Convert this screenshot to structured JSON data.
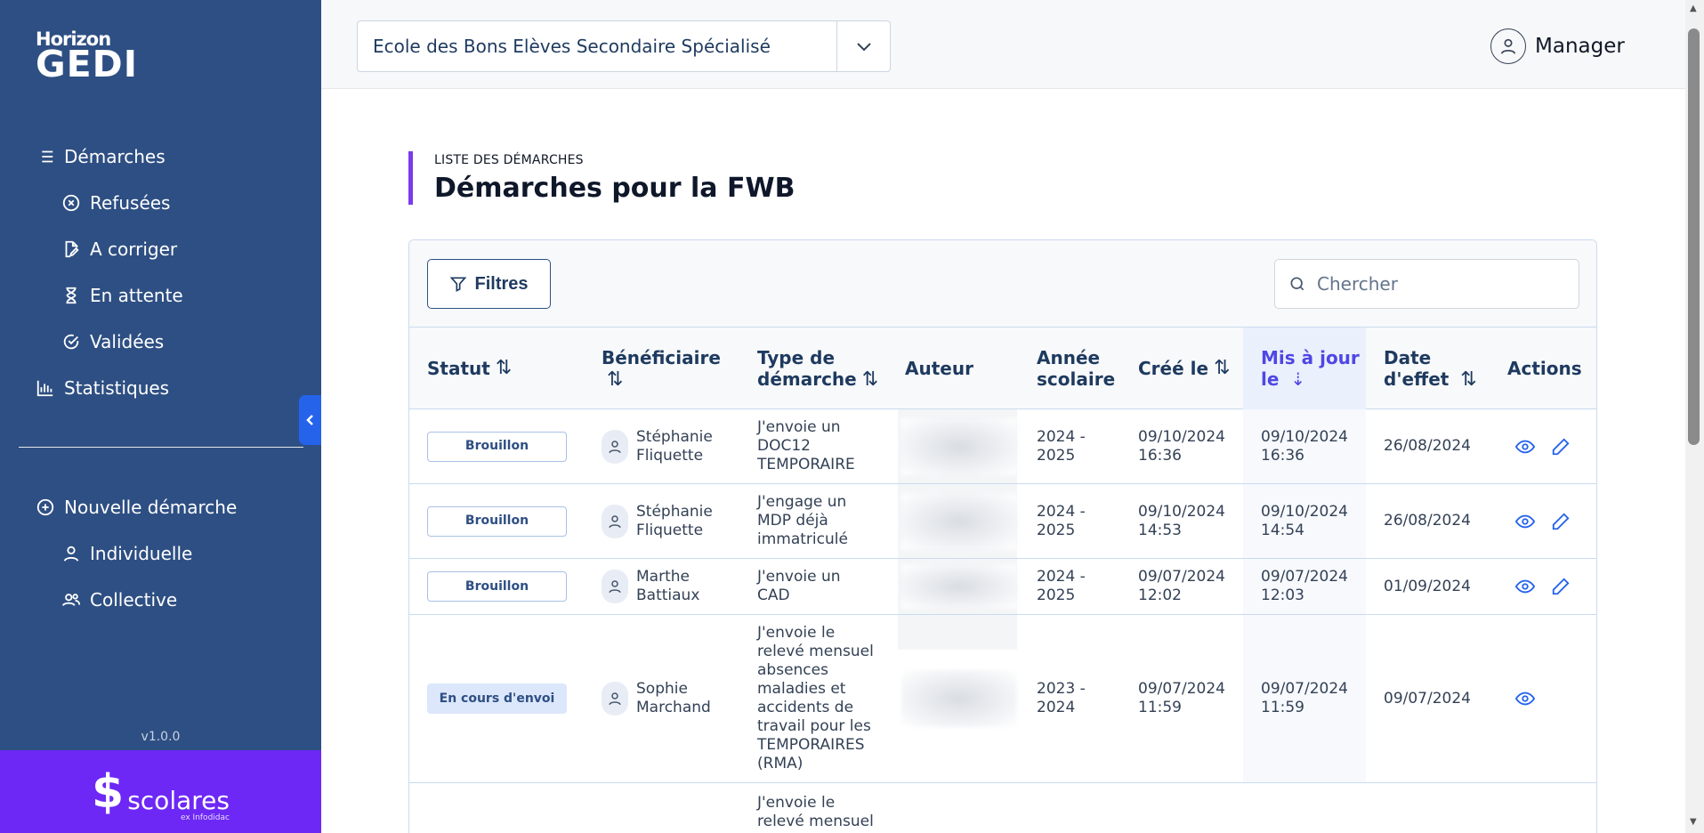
{
  "app": {
    "logo_top": "Horizon",
    "logo_bottom": "GEDI",
    "version": "v1.0.0"
  },
  "sidebar": {
    "items": [
      {
        "label": "Démarches",
        "icon": "list-icon"
      },
      {
        "label": "Refusées",
        "icon": "x-circle-icon"
      },
      {
        "label": "A corriger",
        "icon": "edit-file-icon"
      },
      {
        "label": "En attente",
        "icon": "hourglass-icon"
      },
      {
        "label": "Validées",
        "icon": "check-circle-icon"
      },
      {
        "label": "Statistiques",
        "icon": "bar-chart-icon"
      },
      {
        "label": "Nouvelle démarche",
        "icon": "plus-circle-icon"
      },
      {
        "label": "Individuelle",
        "icon": "user-icon"
      },
      {
        "label": "Collective",
        "icon": "users-icon"
      }
    ]
  },
  "brand": {
    "name": "scolares",
    "sub": "ex Infodidac"
  },
  "topbar": {
    "school": "Ecole des Bons Elèves Secondaire Spécialisé",
    "user": "Manager"
  },
  "page": {
    "kicker": "LISTE DES DÉMARCHES",
    "title": "Démarches pour la FWB"
  },
  "toolbar": {
    "filter_label": "Filtres",
    "search_placeholder": "Chercher"
  },
  "table": {
    "columns": {
      "statut": "Statut",
      "beneficiaire": "Bénéficiaire",
      "type": "Type de démarche",
      "auteur": "Auteur",
      "annee": "Année scolaire",
      "cree": "Créé le",
      "maj": "Mis à jour le",
      "effet": "Date d'effet",
      "actions": "Actions"
    },
    "rows": [
      {
        "status": "Brouillon",
        "ben1": "Stéphanie",
        "ben2": "Fliquette",
        "type1": "J'envoie un",
        "type2": "DOC12",
        "type3": "TEMPORAIRE",
        "annee1": "2024 -",
        "annee2": "2025",
        "cree1": "09/10/2024",
        "cree2": "16:36",
        "maj1": "09/10/2024",
        "maj2": "16:36",
        "effet": "26/08/2024"
      },
      {
        "status": "Brouillon",
        "ben1": "Stéphanie",
        "ben2": "Fliquette",
        "type1": "J'engage un",
        "type2": "MDP déjà",
        "type3": "immatriculé",
        "annee1": "2024 -",
        "annee2": "2025",
        "cree1": "09/10/2024",
        "cree2": "14:53",
        "maj1": "09/10/2024",
        "maj2": "14:54",
        "effet": "26/08/2024"
      },
      {
        "status": "Brouillon",
        "ben1": "Marthe",
        "ben2": "Battiaux",
        "type1": "J'envoie un",
        "type2": "CAD",
        "type3": "",
        "annee1": "2024 -",
        "annee2": "2025",
        "cree1": "09/07/2024",
        "cree2": "12:02",
        "maj1": "09/07/2024",
        "maj2": "12:03",
        "effet": "01/09/2024"
      },
      {
        "status": "En cours d'envoi",
        "ben1": "Sophie",
        "ben2": "Marchand",
        "type_lines": [
          "J'envoie le",
          "relevé mensuel",
          "absences",
          "maladies et",
          "accidents de",
          "travail pour les",
          "TEMPORAIRES",
          "(RMA)"
        ],
        "annee1": "2023 -",
        "annee2": "2024",
        "cree1": "09/07/2024",
        "cree2": "11:59",
        "maj1": "09/07/2024",
        "maj2": "11:59",
        "effet": "09/07/2024"
      },
      {
        "type_lines": [
          "J'envoie le",
          "relevé mensuel"
        ]
      }
    ]
  },
  "colors": {
    "sidebar": "#2e4f83",
    "accent_purple": "#7c3aed",
    "brand_purple": "#6d28f5",
    "action_blue": "#2563eb"
  }
}
